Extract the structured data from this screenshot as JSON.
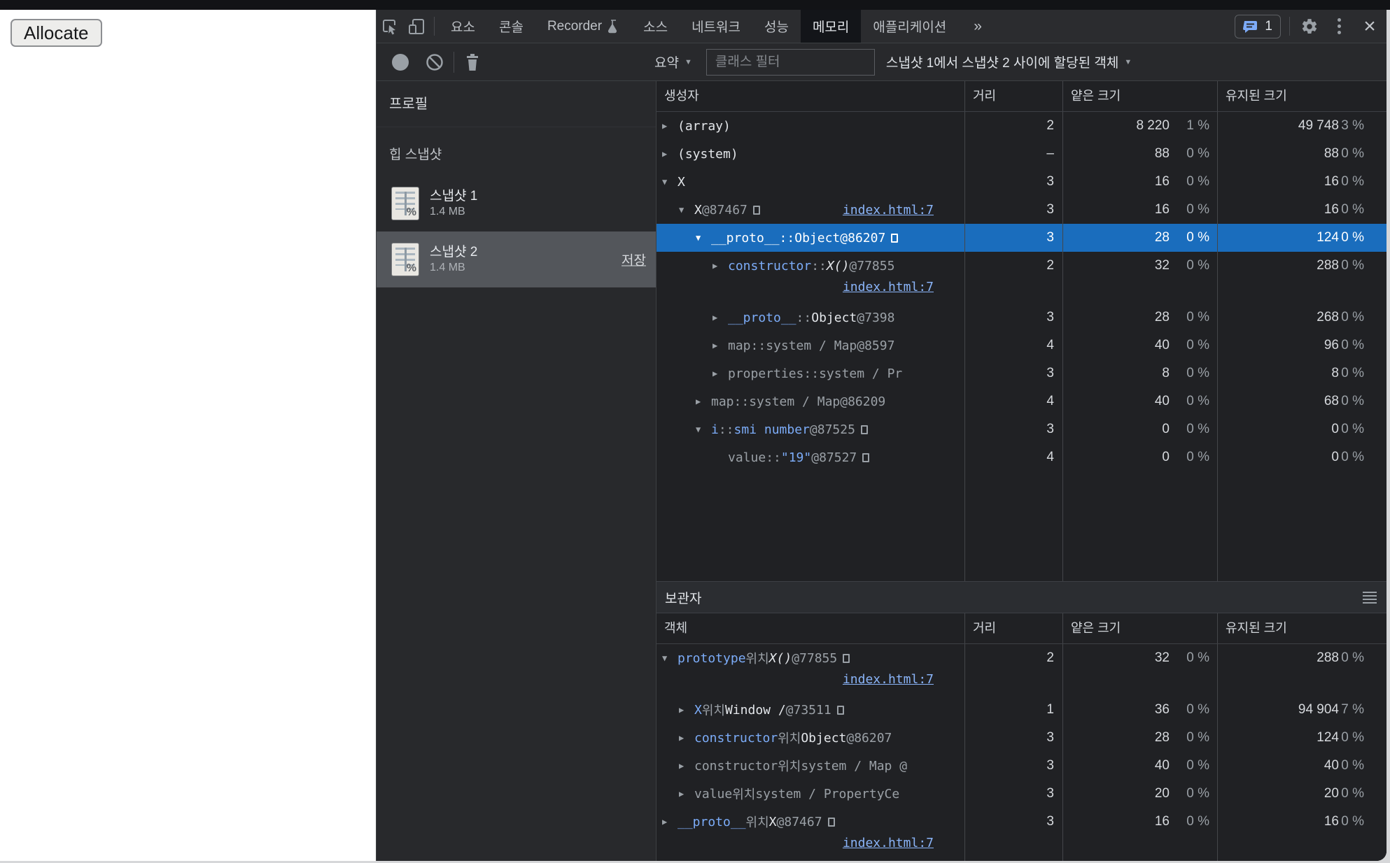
{
  "page": {
    "allocate_button": "Allocate"
  },
  "colors": {
    "selection_blue": "#1a6dbd",
    "property_blue": "#7cacf8",
    "link_blue": "#8ab4f8",
    "grid_background": "#202124",
    "toolbar_background": "#28292c"
  },
  "devtools": {
    "tabs": {
      "items": [
        {
          "name": "elements",
          "label": "요소"
        },
        {
          "name": "console",
          "label": "콘솔"
        },
        {
          "name": "recorder",
          "label": "Recorder",
          "badge": "flask-icon"
        },
        {
          "name": "sources",
          "label": "소스"
        },
        {
          "name": "network",
          "label": "네트워크"
        },
        {
          "name": "performance",
          "label": "성능"
        },
        {
          "name": "memory",
          "label": "메모리",
          "selected": true
        },
        {
          "name": "application",
          "label": "애플리케이션"
        }
      ],
      "more_symbol": "»",
      "issues_count": "1",
      "close_symbol": "×"
    },
    "toolbar": {
      "view_select": "요약",
      "filter_placeholder": "클래스 필터",
      "range_select": "스냅샷 1에서 스냅샷 2 사이에 할당된 객체"
    },
    "sidebar": {
      "profiles_title": "프로필",
      "section_title": "힙 스냅샷",
      "snapshots": [
        {
          "title": "스냅샷 1",
          "size": "1.4 MB",
          "selected": false,
          "action": ""
        },
        {
          "title": "스냅샷 2",
          "size": "1.4 MB",
          "selected": true,
          "action": "저장"
        }
      ]
    },
    "constructor_view": {
      "columns": [
        "생성자",
        "거리",
        "얕은 크기",
        "유지된 크기"
      ],
      "rows": [
        {
          "indent": 0,
          "arrow": "collapsed",
          "segments": [
            [
              "obj",
              "(array)"
            ]
          ],
          "distance": "2",
          "shallow": "8 220",
          "shallow_pct": "1 %",
          "retained": "49 748",
          "retained_pct": "3 %"
        },
        {
          "indent": 0,
          "arrow": "collapsed",
          "segments": [
            [
              "obj",
              "(system)"
            ]
          ],
          "distance": "–",
          "shallow": "88",
          "shallow_pct": "0 %",
          "retained": "88",
          "retained_pct": "0 %"
        },
        {
          "indent": 0,
          "arrow": "expanded",
          "segments": [
            [
              "obj",
              "X"
            ]
          ],
          "distance": "3",
          "shallow": "16",
          "shallow_pct": "0 %",
          "retained": "16",
          "retained_pct": "0 %"
        },
        {
          "indent": 1,
          "arrow": "expanded",
          "segments": [
            [
              "obj",
              "X"
            ],
            [
              "dim",
              " @87467"
            ],
            [
              "box",
              ""
            ]
          ],
          "inline_link": "index.html:7",
          "distance": "3",
          "shallow": "16",
          "shallow_pct": "0 %",
          "retained": "16",
          "retained_pct": "0 %"
        },
        {
          "indent": 2,
          "arrow": "expanded",
          "selected": true,
          "segments": [
            [
              "prop",
              "__proto__"
            ],
            [
              "dim",
              " :: "
            ],
            [
              "obj",
              "Object"
            ],
            [
              "dim",
              " @86207"
            ],
            [
              "box",
              ""
            ]
          ],
          "distance": "3",
          "shallow": "28",
          "shallow_pct": "0 %",
          "retained": "124",
          "retained_pct": "0 %"
        },
        {
          "indent": 3,
          "arrow": "collapsed",
          "segments": [
            [
              "prop",
              "constructor"
            ],
            [
              "dim",
              " :: "
            ],
            [
              "fn",
              "X()"
            ],
            [
              "dim",
              " @77855"
            ]
          ],
          "link": "index.html:7",
          "distance": "2",
          "shallow": "32",
          "shallow_pct": "0 %",
          "retained": "288",
          "retained_pct": "0 %"
        },
        {
          "indent": 3,
          "arrow": "collapsed",
          "segments": [
            [
              "prop",
              "__proto__"
            ],
            [
              "dim",
              " :: "
            ],
            [
              "obj",
              "Object"
            ],
            [
              "dim",
              " @7398"
            ]
          ],
          "distance": "3",
          "shallow": "28",
          "shallow_pct": "0 %",
          "retained": "268",
          "retained_pct": "0 %"
        },
        {
          "indent": 3,
          "arrow": "collapsed",
          "segments": [
            [
              "dim",
              "map"
            ],
            [
              "dim",
              " :: "
            ],
            [
              "dim",
              "system / Map"
            ],
            [
              "dim",
              " @8597"
            ]
          ],
          "distance": "4",
          "shallow": "40",
          "shallow_pct": "0 %",
          "retained": "96",
          "retained_pct": "0 %"
        },
        {
          "indent": 3,
          "arrow": "collapsed",
          "segments": [
            [
              "dim",
              "properties"
            ],
            [
              "dim",
              " :: "
            ],
            [
              "dim",
              "system / Pr"
            ]
          ],
          "distance": "3",
          "shallow": "8",
          "shallow_pct": "0 %",
          "retained": "8",
          "retained_pct": "0 %"
        },
        {
          "indent": 2,
          "arrow": "collapsed",
          "segments": [
            [
              "dim",
              "map"
            ],
            [
              "dim",
              " :: "
            ],
            [
              "dim",
              "system / Map"
            ],
            [
              "dim",
              " @86209"
            ]
          ],
          "distance": "4",
          "shallow": "40",
          "shallow_pct": "0 %",
          "retained": "68",
          "retained_pct": "0 %"
        },
        {
          "indent": 2,
          "arrow": "expanded",
          "segments": [
            [
              "prop",
              "i"
            ],
            [
              "dim",
              " :: "
            ],
            [
              "prop",
              "smi number"
            ],
            [
              "dim",
              " @87525"
            ],
            [
              "box",
              ""
            ]
          ],
          "distance": "3",
          "shallow": "0",
          "shallow_pct": "0 %",
          "retained": "0",
          "retained_pct": "0 %"
        },
        {
          "indent": 3,
          "arrow": "none",
          "segments": [
            [
              "dim",
              "value"
            ],
            [
              "dim",
              " :: "
            ],
            [
              "str",
              "\"19\""
            ],
            [
              "dim",
              " @87527"
            ],
            [
              "box",
              ""
            ]
          ],
          "distance": "4",
          "shallow": "0",
          "shallow_pct": "0 %",
          "retained": "0",
          "retained_pct": "0 %"
        }
      ]
    },
    "retainers": {
      "title": "보관자",
      "columns": [
        "객체",
        "거리",
        "얕은 크기",
        "유지된 크기"
      ],
      "rows": [
        {
          "indent": 0,
          "arrow": "expanded",
          "segments": [
            [
              "prop",
              "prototype"
            ],
            [
              "dim",
              " 위치 "
            ],
            [
              "fn",
              "X()"
            ],
            [
              "dim",
              " @77855"
            ],
            [
              "box",
              ""
            ]
          ],
          "link": "index.html:7",
          "distance": "2",
          "shallow": "32",
          "shallow_pct": "0 %",
          "retained": "288",
          "retained_pct": "0 %"
        },
        {
          "indent": 1,
          "arrow": "collapsed",
          "segments": [
            [
              "prop",
              "X"
            ],
            [
              "dim",
              " 위치 "
            ],
            [
              "obj",
              "Window /"
            ],
            [
              "dim",
              "  @73511"
            ],
            [
              "box",
              ""
            ]
          ],
          "distance": "1",
          "shallow": "36",
          "shallow_pct": "0 %",
          "retained": "94 904",
          "retained_pct": "7 %"
        },
        {
          "indent": 1,
          "arrow": "collapsed",
          "segments": [
            [
              "prop",
              "constructor"
            ],
            [
              "dim",
              " 위치 "
            ],
            [
              "obj",
              "Object"
            ],
            [
              "dim",
              " @86207"
            ]
          ],
          "distance": "3",
          "shallow": "28",
          "shallow_pct": "0 %",
          "retained": "124",
          "retained_pct": "0 %"
        },
        {
          "indent": 1,
          "arrow": "collapsed",
          "segments": [
            [
              "dim",
              "constructor"
            ],
            [
              "dim",
              " 위치 "
            ],
            [
              "dim",
              "system / Map @"
            ]
          ],
          "distance": "3",
          "shallow": "40",
          "shallow_pct": "0 %",
          "retained": "40",
          "retained_pct": "0 %"
        },
        {
          "indent": 1,
          "arrow": "collapsed",
          "segments": [
            [
              "dim",
              "value"
            ],
            [
              "dim",
              " 위치 "
            ],
            [
              "dim",
              "system / PropertyCe"
            ]
          ],
          "distance": "3",
          "shallow": "20",
          "shallow_pct": "0 %",
          "retained": "20",
          "retained_pct": "0 %"
        },
        {
          "indent": 0,
          "arrow": "collapsed",
          "segments": [
            [
              "prop",
              "__proto__"
            ],
            [
              "dim",
              " 위치 "
            ],
            [
              "obj",
              "X"
            ],
            [
              "dim",
              " @87467"
            ],
            [
              "box",
              ""
            ]
          ],
          "link": "index.html:7",
          "distance": "3",
          "shallow": "16",
          "shallow_pct": "0 %",
          "retained": "16",
          "retained_pct": "0 %"
        }
      ]
    }
  }
}
